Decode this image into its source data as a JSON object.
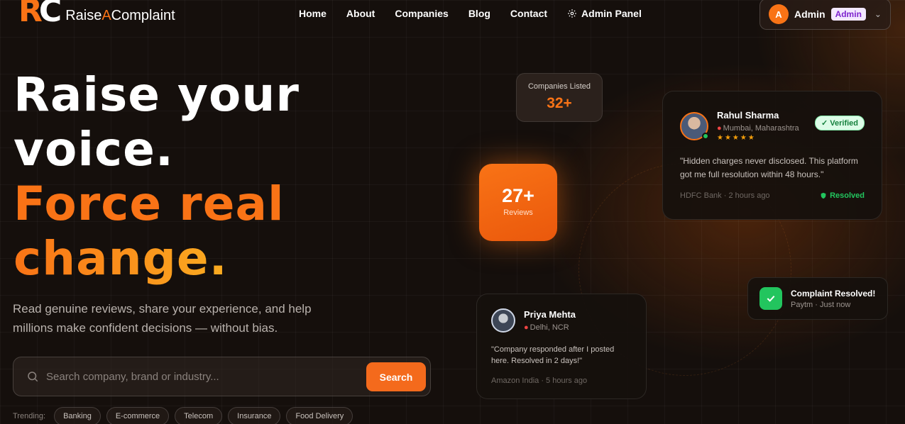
{
  "brand": {
    "mark_r": "R",
    "mark_c": "C",
    "name_part1": "Raise",
    "name_part2": "A",
    "name_part3": "Complaint"
  },
  "nav": {
    "home": "Home",
    "about": "About",
    "companies": "Companies",
    "blog": "Blog",
    "contact": "Contact",
    "admin_panel": "Admin Panel"
  },
  "user": {
    "initial": "A",
    "name": "Admin",
    "role": "Admin"
  },
  "hero": {
    "line1": "Raise your",
    "line2": "voice.",
    "line3": "Force real",
    "line4": "change.",
    "subtitle": "Read genuine reviews, share your experience, and help millions make confident decisions — without bias."
  },
  "search": {
    "placeholder": "Search company, brand or industry...",
    "button": "Search"
  },
  "trending": {
    "label": "Trending:",
    "items": [
      "Banking",
      "E-commerce",
      "Telecom",
      "Insurance",
      "Food Delivery"
    ]
  },
  "stats": {
    "companies": {
      "label": "Companies Listed",
      "value": "32+"
    },
    "reviews": {
      "value": "27+",
      "label": "Reviews"
    }
  },
  "reviews": [
    {
      "name": "Rahul Sharma",
      "location": "Mumbai, Maharashtra",
      "rating": 5,
      "badge": "✓ Verified",
      "quote": "\"Hidden charges never disclosed. This platform got me full resolution within 48 hours.\"",
      "meta": "HDFC Bank · 2 hours ago",
      "status": "Resolved"
    },
    {
      "name": "Priya Mehta",
      "location": "Delhi, NCR",
      "quote": "\"Company responded after I posted here. Resolved in 2 days!\"",
      "meta": "Amazon India · 5 hours ago"
    }
  ],
  "toast": {
    "title": "Complaint Resolved!",
    "subtitle": "Paytm · Just now"
  },
  "colors": {
    "accent": "#f97316",
    "success": "#22c55e",
    "background": "#150f0c",
    "admin_badge": "#7e22ce"
  }
}
